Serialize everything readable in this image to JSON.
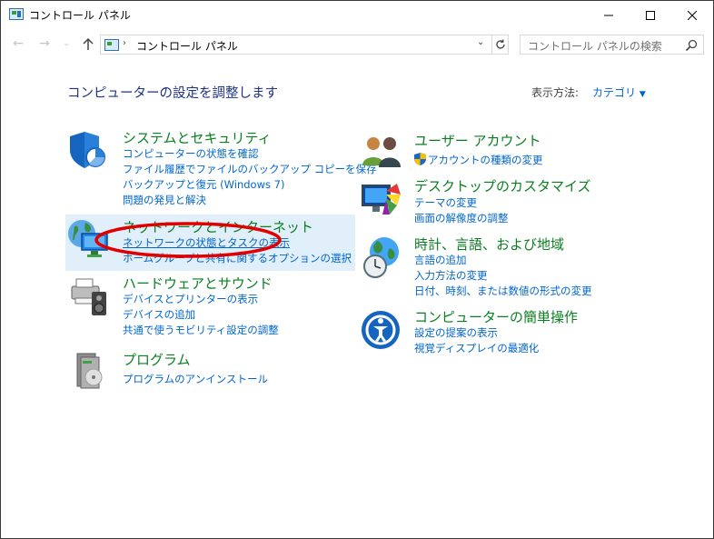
{
  "window": {
    "title": "コントロール パネル"
  },
  "address_bar": {
    "path": "コントロール パネル"
  },
  "search": {
    "placeholder": "コントロール パネルの検索"
  },
  "header": {
    "title": "コンピューターの設定を調整します",
    "view_label": "表示方法:",
    "view_value": "カテゴリ"
  },
  "categories_left": [
    {
      "title": "システムとセキュリティ",
      "icon": "shield-icon",
      "links": [
        "コンピューターの状態を確認",
        "ファイル履歴でファイルのバックアップ コピーを保存",
        "バックアップと復元 (Windows 7)",
        "問題の発見と解決"
      ]
    },
    {
      "title": "ネットワークとインターネット",
      "icon": "network-globe-icon",
      "links": [
        "ネットワークの状態とタスクの表示",
        "ホームグループと共有に関するオプションの選択"
      ]
    },
    {
      "title": "ハードウェアとサウンド",
      "icon": "printer-speaker-icon",
      "links": [
        "デバイスとプリンターの表示",
        "デバイスの追加",
        "共通で使うモビリティ設定の調整"
      ]
    },
    {
      "title": "プログラム",
      "icon": "programs-box-icon",
      "links": [
        "プログラムのアンインストール"
      ]
    }
  ],
  "categories_right": [
    {
      "title": "ユーザー アカウント",
      "icon": "users-icon",
      "links": [
        "アカウントの種類の変更"
      ]
    },
    {
      "title": "デスクトップのカスタマイズ",
      "icon": "monitor-palette-icon",
      "links": [
        "テーマの変更",
        "画面の解像度の調整"
      ]
    },
    {
      "title": "時計、言語、および地域",
      "icon": "globe-clock-icon",
      "links": [
        "言語の追加",
        "入力方法の変更",
        "日付、時刻、または数値の形式の変更"
      ]
    },
    {
      "title": "コンピューターの簡単操作",
      "icon": "ease-of-access-icon",
      "links": [
        "設定の提案の表示",
        "視覚ディスプレイの最適化"
      ]
    }
  ],
  "colors": {
    "category_title": "#0a7f20",
    "link": "#0066cc",
    "page_title": "#1e3287",
    "hover_background": "#e1effa",
    "annotation_ellipse": "#e00000"
  }
}
